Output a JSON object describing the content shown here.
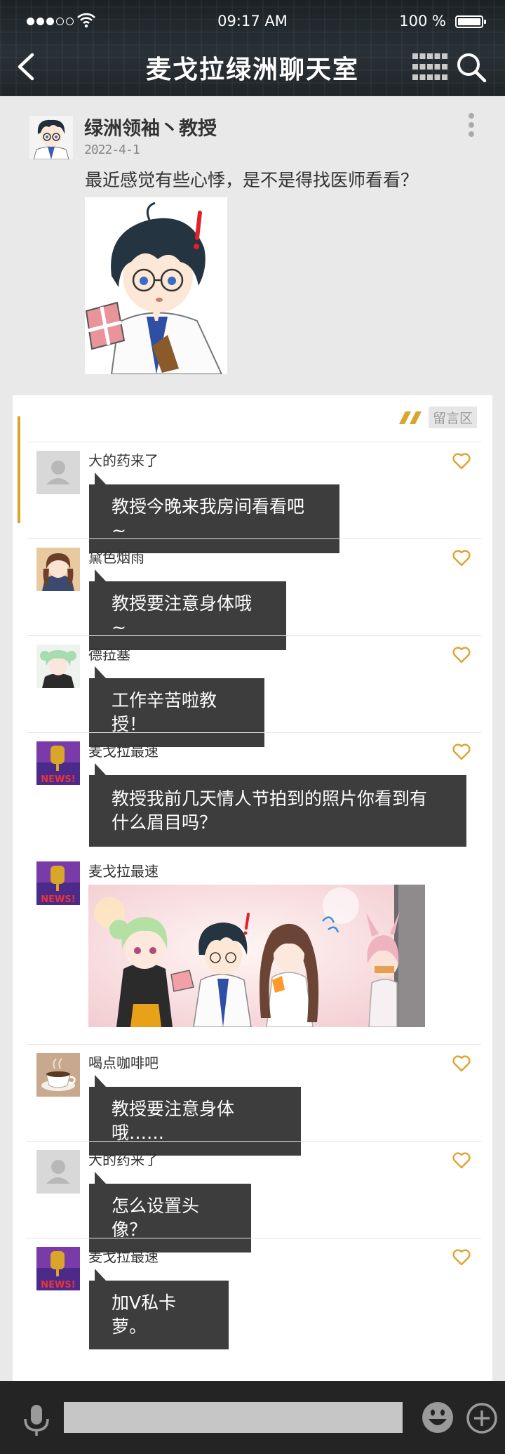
{
  "status_bar": {
    "time": "09:17 AM",
    "battery": "100 %"
  },
  "nav": {
    "title": "麦戈拉绿洲聊天室"
  },
  "post": {
    "author": "绿洲领袖丶教授",
    "date": "2022-4-1",
    "text": "最近感觉有些心悸，是不是得找医师看看？"
  },
  "comments_section": {
    "label": "留言区"
  },
  "comments": [
    {
      "name": "大的药来了",
      "text": "教授今晚来我房间看看吧~"
    },
    {
      "name": "黛色烟雨",
      "text": "教授要注意身体哦~"
    },
    {
      "name": "德菈塞",
      "text": "工作辛苦啦教授！"
    },
    {
      "name": "麦戈拉最速",
      "text_line1": "教授我前几天情人节拍到的照片你看到有",
      "text_line2": "什么眉目吗？"
    },
    {
      "name": "麦戈拉最速"
    },
    {
      "name": "喝点咖啡吧",
      "text": "教授要注意身体哦……"
    },
    {
      "name": "大的药来了",
      "text": "怎么设置头像？"
    },
    {
      "name": "麦戈拉最速",
      "text": "加V私卡萝。"
    }
  ],
  "news_badge": "NEWS!",
  "colors": {
    "accent": "#d9a52c",
    "bubble": "#3d3d3d",
    "header": "#1f2428",
    "bottom_bar": "#242424"
  }
}
